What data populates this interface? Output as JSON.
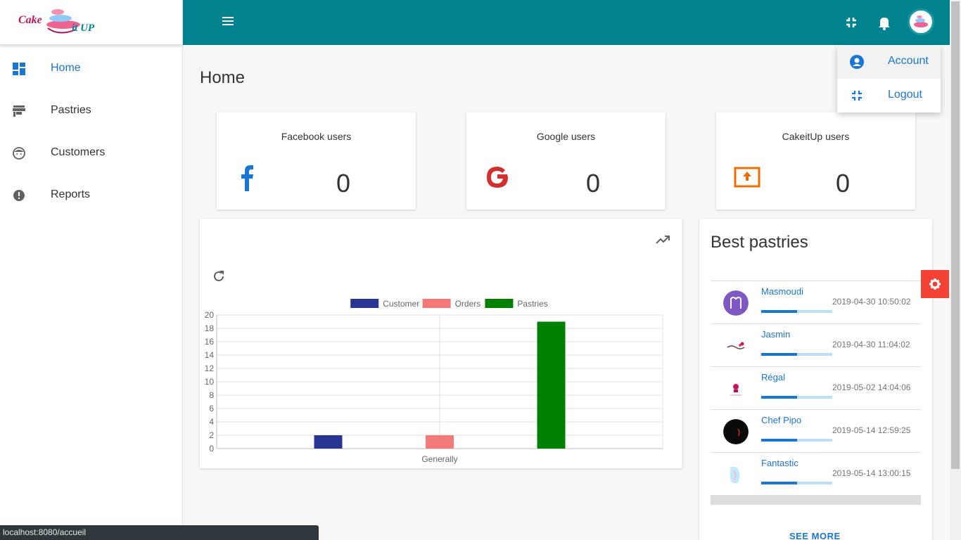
{
  "brand": {
    "logo_text_1": "Cake",
    "logo_text_2": "it UP"
  },
  "sidebar": {
    "items": [
      {
        "label": "Home",
        "icon": "dashboard-icon",
        "active": true
      },
      {
        "label": "Pastries",
        "icon": "store-icon",
        "active": false
      },
      {
        "label": "Customers",
        "icon": "face-icon",
        "active": false
      },
      {
        "label": "Reports",
        "icon": "alert-circle-icon",
        "active": false
      }
    ]
  },
  "topbar": {
    "icons": [
      "menu-icon",
      "fullscreen-exit-icon",
      "notifications-icon",
      "avatar"
    ],
    "color": "#00838f"
  },
  "page": {
    "title": "Home"
  },
  "stats": [
    {
      "title": "Facebook users",
      "value": "0",
      "icon": "facebook-icon",
      "color": "#1976d2"
    },
    {
      "title": "Google users",
      "value": "0",
      "icon": "google-icon",
      "color": "#d32f2f"
    },
    {
      "title": "CakeitUp users",
      "value": "0",
      "icon": "upload-box-icon",
      "color": "#ef6c00"
    }
  ],
  "chart_data": {
    "type": "bar",
    "categories": [
      "Generally"
    ],
    "series": [
      {
        "name": "Customer",
        "values": [
          2
        ],
        "color": "#283593"
      },
      {
        "name": "Orders",
        "values": [
          2
        ],
        "color": "#f47a7a"
      },
      {
        "name": "Pastries",
        "values": [
          19
        ],
        "color": "#008000"
      }
    ],
    "ylim": [
      0,
      20
    ],
    "yticks": [
      "0",
      "2",
      "4",
      "6",
      "8",
      "10",
      "12",
      "14",
      "16",
      "18",
      "20"
    ],
    "xlabel": "Generally",
    "legend": "top-center",
    "grid": true
  },
  "best": {
    "title": "Best pastries",
    "items": [
      {
        "name": "Masmoudi",
        "date": "2019-04-30 10:50:02",
        "progress": 0.5
      },
      {
        "name": "Jasmin",
        "date": "2019-04-30 11:04:02",
        "progress": 0.5
      },
      {
        "name": "Régal",
        "date": "2019-05-02 14:04:06",
        "progress": 0.5
      },
      {
        "name": "Chef Pipo",
        "date": "2019-05-14 12:59:25",
        "progress": 0.5
      },
      {
        "name": "Fantastic",
        "date": "2019-05-14 13:00:15",
        "progress": 0.5
      }
    ],
    "see_more": "SEE MORE"
  },
  "dropdown": {
    "items": [
      {
        "label": "Account",
        "icon": "account-circle-icon"
      },
      {
        "label": "Logout",
        "icon": "fullscreen-exit-icon"
      }
    ]
  },
  "status_url": "localhost:8080/accueil"
}
